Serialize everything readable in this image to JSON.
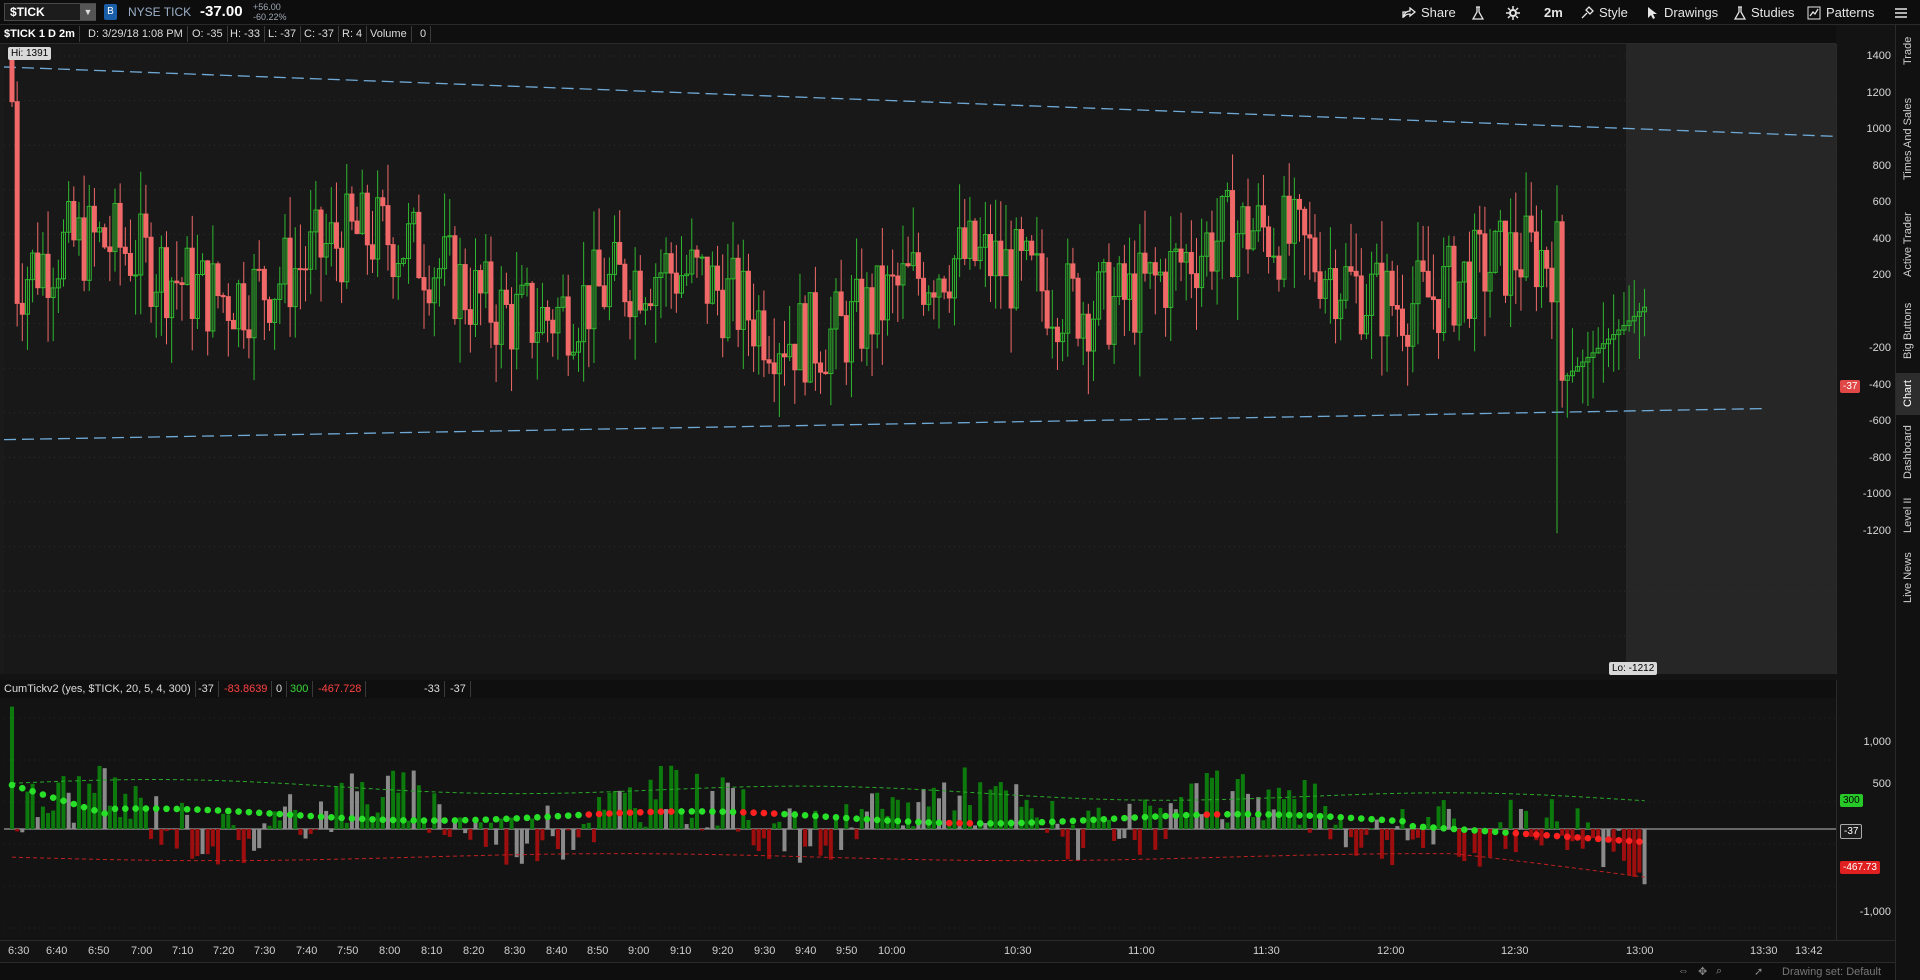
{
  "top": {
    "symbol": "$TICK",
    "symbol_flag": "B",
    "instrument_name": "NYSE TICK",
    "last_price": "-37.00",
    "change": "+56.00",
    "change_pct": "-60.22%",
    "share": "Share",
    "timeframe": "2m",
    "style": "Style",
    "drawings": "Drawings",
    "studies": "Studies",
    "patterns": "Patterns"
  },
  "sidebar_tabs": [
    "Trade",
    "Times And Sales",
    "Active Trader",
    "Big Buttons",
    "Chart",
    "Dashboard",
    "Level II",
    "Live News"
  ],
  "main": {
    "title": "$TICK 1 D 2m",
    "date": "D: 3/29/18 1:08 PM",
    "open": "O: -35",
    "high": "H: -33",
    "low": "L: -37",
    "close": "C: -37",
    "range": "R: 4",
    "volume_label": "Volume",
    "volume_value": "0",
    "hi_label": "Hi: 1391",
    "lo_label": "Lo: -1212",
    "last_tag": "-37",
    "yticks": [
      "1400",
      "1200",
      "1000",
      "800",
      "600",
      "400",
      "200",
      "-200",
      "-400",
      "-600",
      "-800",
      "-1000",
      "-1200"
    ]
  },
  "lower": {
    "study_label": "CumTickv2 (yes, $TICK, 20, 5, 4, 300)",
    "v1": "-37",
    "v2": "-83.8639",
    "v3": "0",
    "v4": "300",
    "v5": "-467.728",
    "v7": "-33",
    "v8": "-37",
    "yticks": [
      "1,000",
      "500",
      "-1,000"
    ],
    "tag_upper": "300",
    "tag_zero": "-37",
    "tag_lower": "-467.73"
  },
  "xaxis": [
    "6:30",
    "6:40",
    "6:50",
    "7:00",
    "7:10",
    "7:20",
    "7:30",
    "7:40",
    "7:50",
    "8:00",
    "8:10",
    "8:20",
    "8:30",
    "8:40",
    "8:50",
    "9:00",
    "9:10",
    "9:20",
    "9:30",
    "9:40",
    "9:50",
    "10:00",
    "10:30",
    "11:00",
    "11:30",
    "12:00",
    "12:30",
    "13:00",
    "13:30",
    "13:42"
  ],
  "bottom": {
    "drawing_set": "Drawing set: Default"
  },
  "colors": {
    "bull": "#2fb72f",
    "bear": "#f06868",
    "trend": "#6fa9d6",
    "cum_green": "#28e028",
    "cum_red": "#ff2020"
  }
}
